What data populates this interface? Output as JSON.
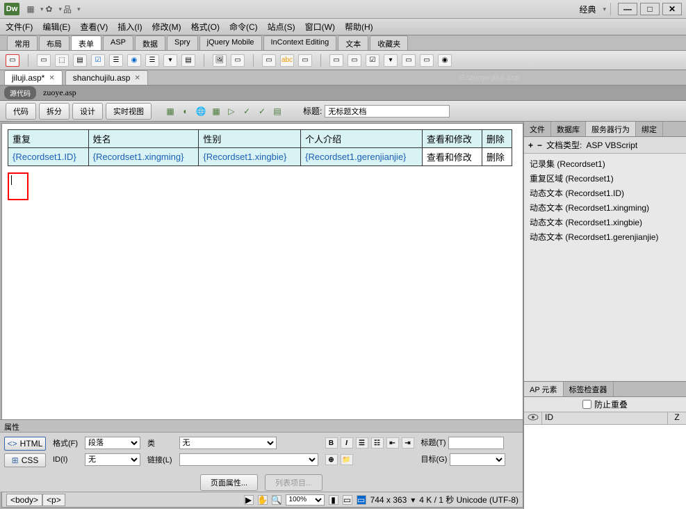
{
  "app": {
    "logo": "Dw",
    "workspace": "经典"
  },
  "menus": [
    "文件(F)",
    "编辑(E)",
    "查看(V)",
    "插入(I)",
    "修改(M)",
    "格式(O)",
    "命令(C)",
    "站点(S)",
    "窗口(W)",
    "帮助(H)"
  ],
  "insert_tabs": [
    "常用",
    "布局",
    "表单",
    "ASP",
    "数据",
    "Spry",
    "jQuery Mobile",
    "InContext Editing",
    "文本",
    "收藏夹"
  ],
  "insert_active": 2,
  "file_tabs": [
    {
      "name": "jiluji.asp*",
      "active": true
    },
    {
      "name": "shanchujilu.asp",
      "active": false
    }
  ],
  "file_path": "G:\\zuoye\\jiluji.asp",
  "sub_source": "源代码",
  "sub_file": "zuoye.asp",
  "view_buttons": {
    "code": "代码",
    "split": "拆分",
    "design": "设计",
    "live": "实时视图"
  },
  "title_label": "标题:",
  "title_value": "无标题文档",
  "table": {
    "headers": [
      "重复",
      "姓名",
      "性别",
      "个人介绍",
      "查看和修改",
      "删除"
    ],
    "row": [
      "{Recordset1.ID}",
      "{Recordset1.xingming}",
      "{Recordset1.xingbie}",
      "{Recordset1.gerenjianjie}",
      "查看和修改",
      "删除"
    ]
  },
  "status": {
    "tags": [
      "<body>",
      "<p>"
    ],
    "zoom": "100%",
    "dims": "744 x 363",
    "size": "4 K / 1 秒 Unicode (UTF-8)"
  },
  "right_panel1": {
    "tabs": [
      "文件",
      "数据库",
      "服务器行为",
      "绑定"
    ],
    "active": 2,
    "doc_type_label": "文档类型:",
    "doc_type": "ASP VBScript",
    "items": [
      "记录集 (Recordset1)",
      "重复区域 (Recordset1)",
      "动态文本 (Recordset1.ID)",
      "动态文本 (Recordset1.xingming)",
      "动态文本 (Recordset1.xingbie)",
      "动态文本 (Recordset1.gerenjianjie)"
    ]
  },
  "right_panel2": {
    "tabs": [
      "AP 元素",
      "标签检查器"
    ],
    "active": 0,
    "prevent": "防止重叠",
    "cols": {
      "id": "ID",
      "z": "Z"
    }
  },
  "properties": {
    "title": "属性",
    "html_btn": "HTML",
    "css_btn": "CSS",
    "format_l": "格式(F)",
    "format_v": "段落",
    "id_l": "ID(I)",
    "id_v": "无",
    "class_l": "类",
    "class_v": "无",
    "link_l": "链接(L)",
    "link_v": "",
    "title2_l": "标题(T)",
    "target_l": "目标(G)",
    "page_props": "页面属性...",
    "list_item": "列表项目..."
  }
}
